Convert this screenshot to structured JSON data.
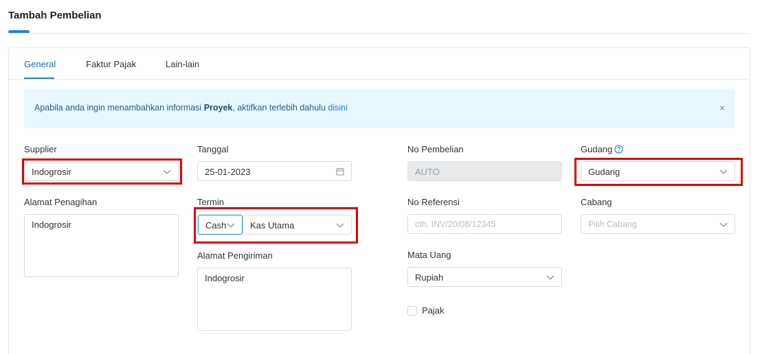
{
  "page": {
    "title": "Tambah Pembelian"
  },
  "tabs": [
    {
      "label": "General",
      "active": true
    },
    {
      "label": "Faktur Pajak",
      "active": false
    },
    {
      "label": "Lain-lain",
      "active": false
    }
  ],
  "alert": {
    "text_before": "Apabila anda ingin menambahkan informasi ",
    "bold": "Proyek",
    "text_after": ", aktifkan terlebih dahulu ",
    "link": "disini",
    "close": "×"
  },
  "form": {
    "supplier": {
      "label": "Supplier",
      "value": "Indogrosir"
    },
    "alamat_penagihan": {
      "label": "Alamat Penagihan",
      "value": "Indogrosir"
    },
    "tanggal": {
      "label": "Tanggal",
      "value": "25-01-2023"
    },
    "termin": {
      "label": "Termin",
      "type_value": "Cash",
      "account_value": "Kas Utama"
    },
    "alamat_pengiriman": {
      "label": "Alamat Pengiriman",
      "value": "Indogrosir"
    },
    "no_pembelian": {
      "label": "No Pembelian",
      "value": "AUTO"
    },
    "no_referensi": {
      "label": "No Referensi",
      "placeholder": "cth. INV/20/08/12345"
    },
    "mata_uang": {
      "label": "Mata Uang",
      "value": "Rupiah"
    },
    "pajak": {
      "label": "Pajak",
      "checked": false
    },
    "gudang": {
      "label": "Gudang",
      "value": "Gudang"
    },
    "cabang": {
      "label": "Cabang",
      "placeholder": "Pilih Cabang"
    }
  },
  "colors": {
    "accent": "#1a84d6",
    "highlight": "#e00000",
    "alert_bg": "#e8f6fd"
  }
}
